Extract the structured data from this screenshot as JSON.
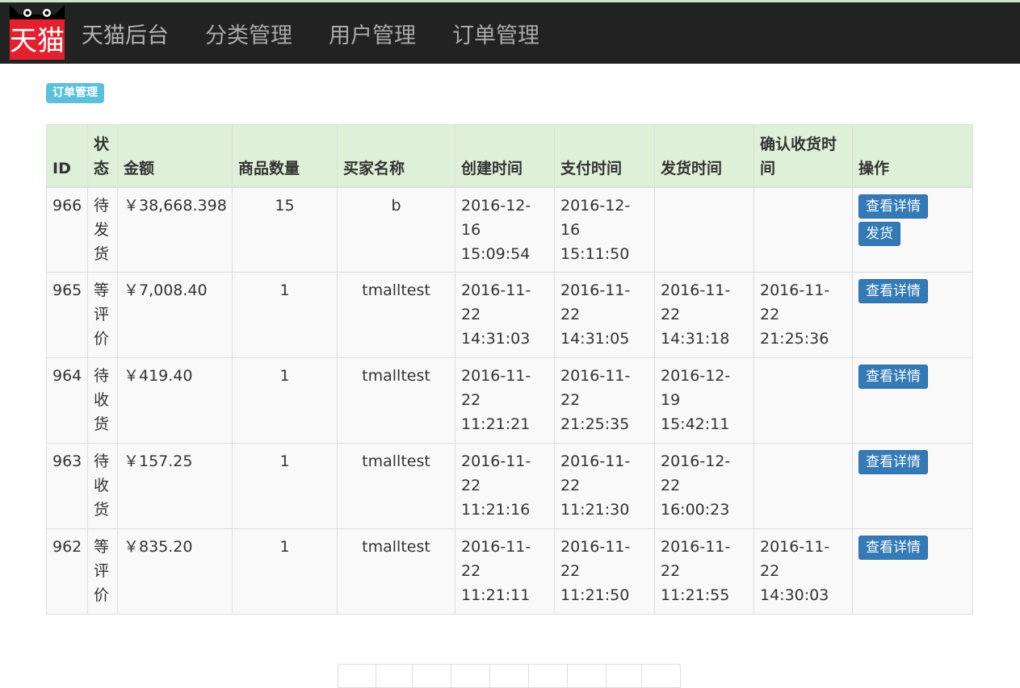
{
  "nav": {
    "logo_text": "天猫",
    "brand": "天猫后台",
    "items": [
      {
        "label": "分类管理"
      },
      {
        "label": "用户管理"
      },
      {
        "label": "订单管理"
      }
    ]
  },
  "page_label": "订单管理",
  "table": {
    "headers": {
      "id": "ID",
      "status": "状态",
      "amount": "金额",
      "quantity": "商品数量",
      "buyer": "买家名称",
      "created": "创建时间",
      "paid": "支付时间",
      "shipped": "发货时间",
      "confirmed": "确认收货时间",
      "actions": "操作"
    },
    "rows": [
      {
        "id": "966",
        "status": "待发货",
        "amount": "￥38,668.398",
        "quantity": "15",
        "buyer": "b",
        "created": "2016-12-16 15:09:54",
        "paid": "2016-12-16 15:11:50",
        "shipped": "",
        "confirmed": "",
        "detail_button": "查看详情",
        "ship_button": "发货"
      },
      {
        "id": "965",
        "status": "等评价",
        "amount": "￥7,008.40",
        "quantity": "1",
        "buyer": "tmalltest",
        "created": "2016-11-22 14:31:03",
        "paid": "2016-11-22 14:31:05",
        "shipped": "2016-11-22 14:31:18",
        "confirmed": "2016-11-22 21:25:36",
        "detail_button": "查看详情"
      },
      {
        "id": "964",
        "status": "待收货",
        "amount": "￥419.40",
        "quantity": "1",
        "buyer": "tmalltest",
        "created": "2016-11-22 11:21:21",
        "paid": "2016-11-22 21:25:35",
        "shipped": "2016-12-19 15:42:11",
        "confirmed": "",
        "detail_button": "查看详情"
      },
      {
        "id": "963",
        "status": "待收货",
        "amount": "￥157.25",
        "quantity": "1",
        "buyer": "tmalltest",
        "created": "2016-11-22 11:21:16",
        "paid": "2016-11-22 11:21:30",
        "shipped": "2016-12-22 16:00:23",
        "confirmed": "",
        "detail_button": "查看详情"
      },
      {
        "id": "962",
        "status": "等评价",
        "amount": "￥835.20",
        "quantity": "1",
        "buyer": "tmalltest",
        "created": "2016-11-22 11:21:11",
        "paid": "2016-11-22 11:21:50",
        "shipped": "2016-11-22 11:21:55",
        "confirmed": "2016-11-22 14:30:03",
        "detail_button": "查看详情"
      }
    ]
  },
  "colors": {
    "navbar": "#222222",
    "header_row": "#dff0d8",
    "label": "#5bc0de",
    "button": "#337ab7",
    "logo": "#ff0036"
  }
}
